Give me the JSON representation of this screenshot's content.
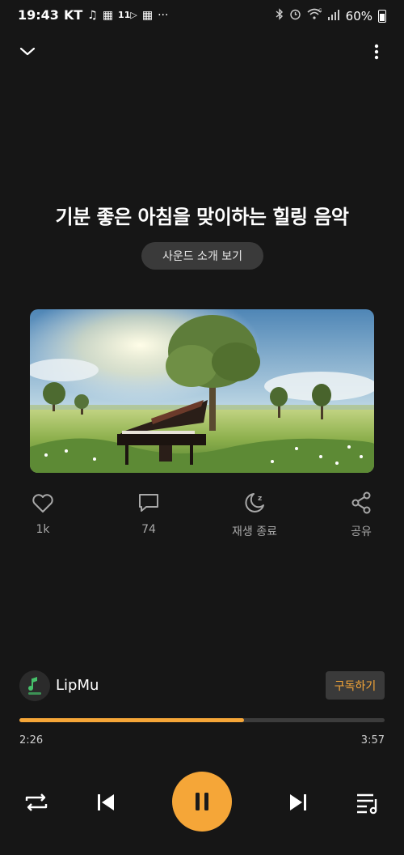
{
  "status_bar": {
    "time": "19:43",
    "carrier": "KT",
    "battery": "60%",
    "left_icons": [
      "music-note-icon",
      "gallery-icon",
      "eleven-icon",
      "gallery-icon",
      "more-dots-icon"
    ],
    "right_icons": [
      "bluetooth-icon",
      "alarm-icon",
      "wifi-icon",
      "signal-icon",
      "battery-icon"
    ]
  },
  "top_bar": {
    "collapse_icon": "chevron-down-icon",
    "menu_icon": "more-vertical-icon"
  },
  "track": {
    "title": "기분 좋은 아침을 맞이하는 힐링 음악",
    "intro_button": "사운드 소개 보기"
  },
  "actions": {
    "like": {
      "icon": "heart-icon",
      "label": "1k"
    },
    "comment": {
      "icon": "comment-icon",
      "label": "74"
    },
    "sleep": {
      "icon": "sleep-timer-icon",
      "label": "재생 종료"
    },
    "share": {
      "icon": "share-icon",
      "label": "공유"
    }
  },
  "channel": {
    "name": "LipMu",
    "subscribe_label": "구독하기"
  },
  "progress": {
    "elapsed": "2:26",
    "total": "3:57",
    "fraction": 0.6161
  },
  "controls": {
    "repeat_icon": "repeat-icon",
    "previous_icon": "skip-previous-icon",
    "pause_icon": "pause-icon",
    "next_icon": "skip-next-icon",
    "playlist_icon": "playlist-icon"
  },
  "colors": {
    "accent": "#f5a638",
    "background": "#161616",
    "muted_text": "#a8a8a8"
  }
}
